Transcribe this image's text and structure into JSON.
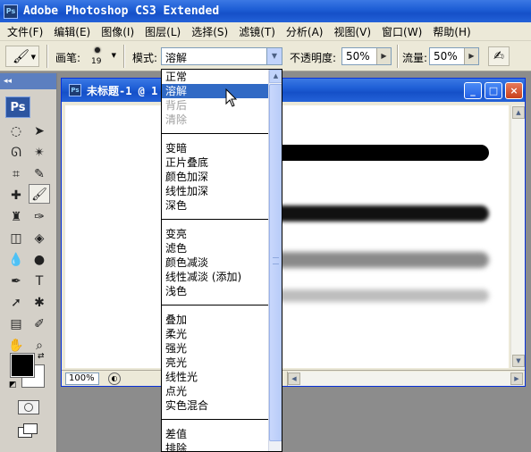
{
  "window": {
    "title": "Adobe Photoshop CS3 Extended",
    "icon": "Ps"
  },
  "menu": [
    "文件(F)",
    "编辑(E)",
    "图像(I)",
    "图层(L)",
    "选择(S)",
    "滤镜(T)",
    "分析(A)",
    "视图(V)",
    "窗口(W)",
    "帮助(H)"
  ],
  "options": {
    "brush_label": "画笔:",
    "brush_size": "19",
    "mode_label": "模式:",
    "mode_value": "溶解",
    "opacity_label": "不透明度:",
    "opacity_value": "50%",
    "flow_label": "流量:",
    "flow_value": "50%"
  },
  "toolbox": {
    "grip": "◂◂",
    "logo": "Ps"
  },
  "document": {
    "icon": "Ps",
    "title": "未标题-1 @ 1",
    "zoom": "100%",
    "minimize": "_",
    "maximize": "□",
    "close": "×"
  },
  "blend_modes": {
    "items": [
      {
        "label": "正常",
        "state": "normal"
      },
      {
        "label": "溶解",
        "state": "selected"
      },
      {
        "label": "背后",
        "state": "disabled"
      },
      {
        "label": "清除",
        "state": "disabled"
      },
      {
        "label": "",
        "state": "separator"
      },
      {
        "label": "变暗",
        "state": "normal"
      },
      {
        "label": "正片叠底",
        "state": "normal"
      },
      {
        "label": "颜色加深",
        "state": "normal"
      },
      {
        "label": "线性加深",
        "state": "normal"
      },
      {
        "label": "深色",
        "state": "normal"
      },
      {
        "label": "",
        "state": "separator"
      },
      {
        "label": "变亮",
        "state": "normal"
      },
      {
        "label": "滤色",
        "state": "normal"
      },
      {
        "label": "颜色减淡",
        "state": "normal"
      },
      {
        "label": "线性减淡 (添加)",
        "state": "normal"
      },
      {
        "label": "浅色",
        "state": "normal"
      },
      {
        "label": "",
        "state": "separator"
      },
      {
        "label": "叠加",
        "state": "normal"
      },
      {
        "label": "柔光",
        "state": "normal"
      },
      {
        "label": "强光",
        "state": "normal"
      },
      {
        "label": "亮光",
        "state": "normal"
      },
      {
        "label": "线性光",
        "state": "normal"
      },
      {
        "label": "点光",
        "state": "normal"
      },
      {
        "label": "实色混合",
        "state": "normal"
      },
      {
        "label": "",
        "state": "separator"
      },
      {
        "label": "差值",
        "state": "normal"
      },
      {
        "label": "排除",
        "state": "normal"
      }
    ]
  },
  "colors": {
    "titlebar": "#1f5fd6",
    "selection": "#316ac5",
    "foreground": "#000000",
    "background": "#ffffff"
  }
}
